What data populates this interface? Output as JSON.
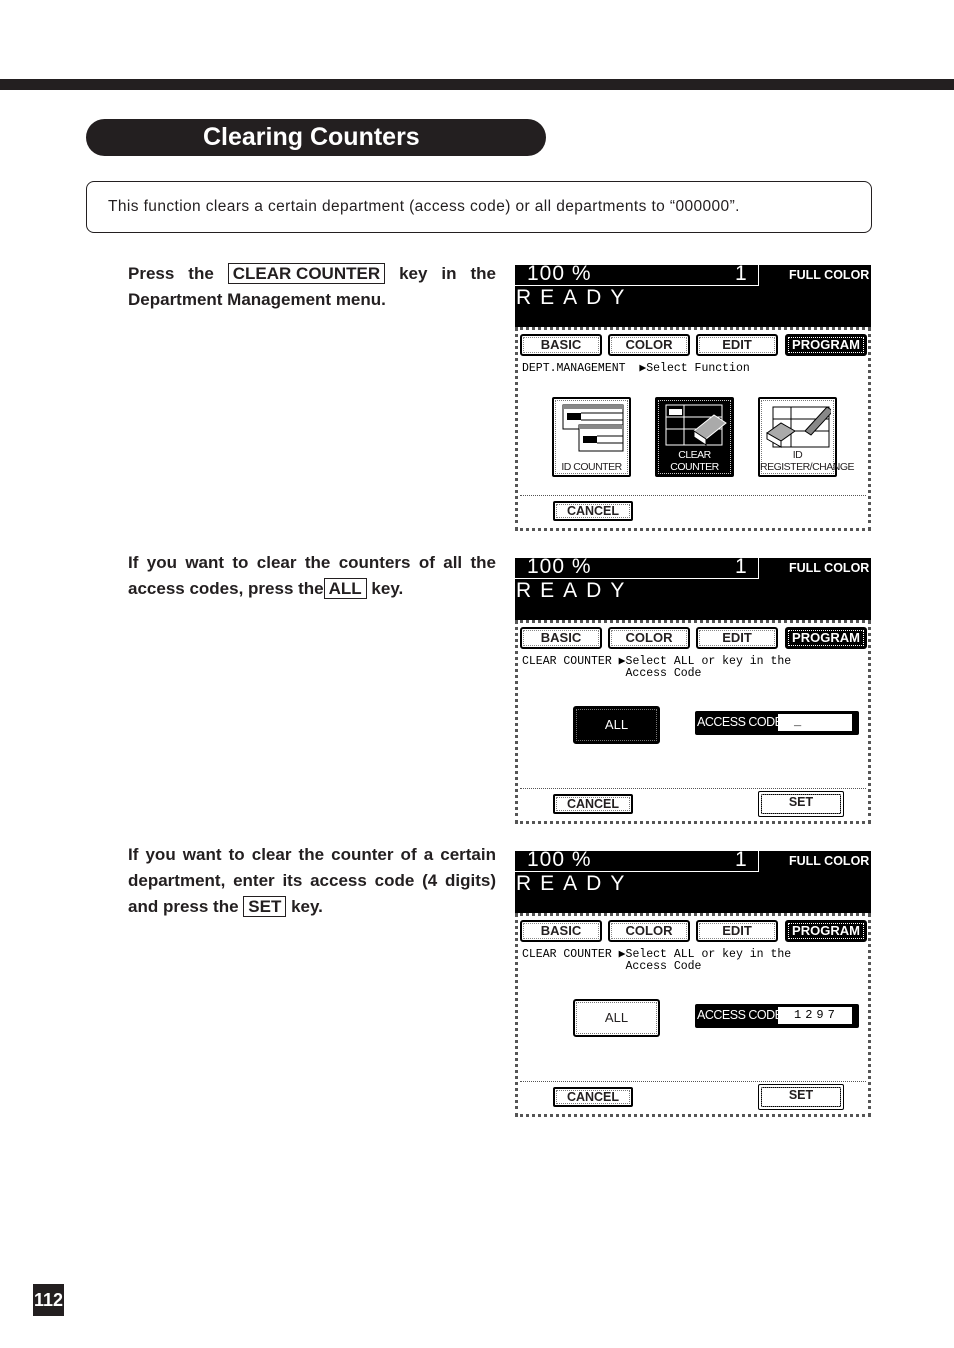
{
  "page": {
    "title": "Clearing Counters",
    "intro": "This function clears a certain department (access code) or all departments to “000000”.",
    "page_number": "112"
  },
  "steps": [
    {
      "before": "Press the",
      "key": "CLEAR COUNTER",
      "after": "key in the",
      "line2": "Department Management menu."
    },
    {
      "line1": "If you want to clear the counters of all the",
      "before": "access codes, press the",
      "key": "ALL",
      "after": "key."
    },
    {
      "line1": "If you want to clear the counter of a certain",
      "line2": "department, enter its access code (4 digits)",
      "before": "and press the",
      "key": "SET",
      "after": "key."
    }
  ],
  "screens": [
    {
      "zoom": "100  %",
      "copies": "1",
      "color_mode": "FULL COLOR",
      "status": "READY",
      "tabs": [
        "BASIC",
        "COLOR",
        "EDIT",
        "PROGRAM"
      ],
      "active_tab": "PROGRAM",
      "message": "DEPT.MANAGEMENT  ▶Select Function",
      "functions": [
        "ID COUNTER",
        "CLEAR COUNTER",
        "ID REGISTER/CHANGE"
      ],
      "active_function": "CLEAR COUNTER",
      "cancel": "CANCEL"
    },
    {
      "zoom": "100  %",
      "copies": "1",
      "color_mode": "FULL COLOR",
      "status": "READY",
      "tabs": [
        "BASIC",
        "COLOR",
        "EDIT",
        "PROGRAM"
      ],
      "active_tab": "PROGRAM",
      "message": "CLEAR COUNTER ▶Select ALL or key in the\n               Access Code",
      "all": "ALL",
      "all_selected": true,
      "access_label": "ACCESS CODE",
      "access_value": "_",
      "cancel": "CANCEL",
      "set": "SET"
    },
    {
      "zoom": "100  %",
      "copies": "1",
      "color_mode": "FULL COLOR",
      "status": "READY",
      "tabs": [
        "BASIC",
        "COLOR",
        "EDIT",
        "PROGRAM"
      ],
      "active_tab": "PROGRAM",
      "message": "CLEAR COUNTER ▶Select ALL or key in the\n               Access Code",
      "all": "ALL",
      "all_selected": false,
      "access_label": "ACCESS CODE",
      "access_value": "1297",
      "cancel": "CANCEL",
      "set": "SET"
    }
  ]
}
